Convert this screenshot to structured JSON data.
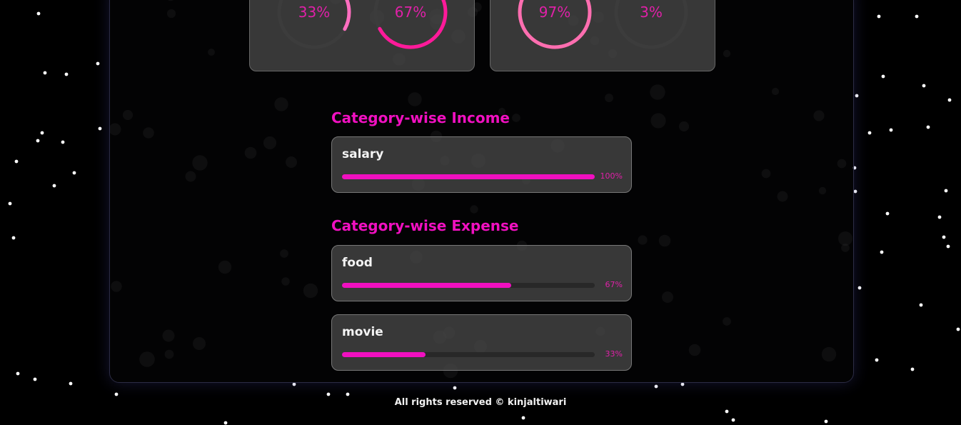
{
  "summary_cards": [
    {
      "rings": [
        {
          "percent": 33,
          "label": "33%",
          "color": "#ff6ec0"
        },
        {
          "percent": 67,
          "label": "67%",
          "color": "#ff1a9a"
        }
      ]
    },
    {
      "rings": [
        {
          "percent": 97,
          "label": "97%",
          "color": "#ff6eb0"
        },
        {
          "percent": 3,
          "label": "3%",
          "color": "#ff3ca0"
        }
      ]
    }
  ],
  "income": {
    "title": "Category-wise Income",
    "items": [
      {
        "name": "salary",
        "percent": 100,
        "label": "100%"
      }
    ]
  },
  "expense": {
    "title": "Category-wise Expense",
    "items": [
      {
        "name": "food",
        "percent": 67,
        "label": "67%"
      },
      {
        "name": "movie",
        "percent": 33,
        "label": "33%"
      }
    ]
  },
  "footer": {
    "text": "All rights reserved © kinjaltiwari"
  },
  "colors": {
    "accent": "#f010c0",
    "card_bg": "#484848",
    "background": "#000000"
  }
}
